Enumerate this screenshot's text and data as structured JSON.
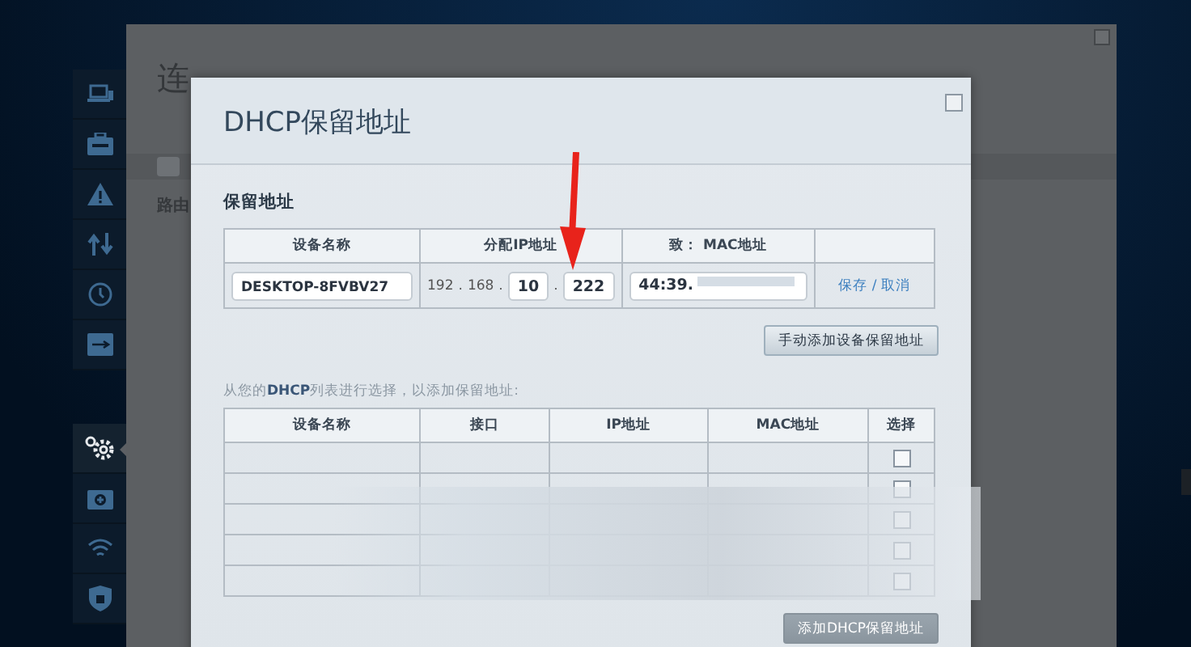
{
  "sidebar": {
    "groups": [
      {
        "items": [
          {
            "kind": "laptop",
            "selected": false
          },
          {
            "kind": "toolbox",
            "selected": false
          },
          {
            "kind": "warning",
            "selected": false
          },
          {
            "kind": "transfer",
            "selected": false
          },
          {
            "kind": "clock",
            "selected": false
          },
          {
            "kind": "usb",
            "selected": false
          }
        ]
      },
      {
        "items": [
          {
            "kind": "gear",
            "selected": true
          },
          {
            "kind": "medkit",
            "selected": false
          },
          {
            "kind": "wifi",
            "selected": false
          },
          {
            "kind": "shield",
            "selected": false
          }
        ]
      }
    ]
  },
  "background_page": {
    "title": "连",
    "section": "路由"
  },
  "dialog": {
    "title": "DHCP保留地址",
    "section_title": "保留地址",
    "reservation_table": {
      "columns": [
        "设备名称",
        "分配IP地址",
        "致： MAC地址"
      ],
      "row": {
        "device_name": "DESKTOP-8FVBV27",
        "ip_separator": ".",
        "ip_parts": [
          {
            "kind": "text",
            "value": "192"
          },
          {
            "kind": "text",
            "value": "168"
          },
          {
            "kind": "field",
            "value": "10"
          },
          {
            "kind": "field",
            "value": "222"
          }
        ],
        "mac": "44:39.",
        "save": "保存",
        "action_separator": "/",
        "cancel": "取消"
      }
    },
    "manual_add_button": "手动添加设备保留地址",
    "hint": "从您的**DHCP**列表进行选择，以添加保留地址:",
    "dhcp_table": {
      "columns": [
        "设备名称",
        "接口",
        "IP地址",
        "MAC地址",
        "选择"
      ],
      "rows": [
        {
          "checked": false
        },
        {
          "checked": false
        },
        {
          "checked": false
        },
        {
          "checked": false
        },
        {
          "checked": false
        }
      ]
    },
    "add_button": {
      "label": "添加DHCP保留地址",
      "disabled": true
    }
  }
}
